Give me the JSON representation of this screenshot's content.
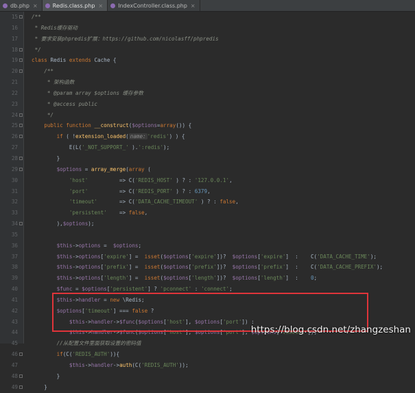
{
  "tabs": [
    {
      "label": "db.php",
      "active": false
    },
    {
      "label": "Redis.class.php",
      "active": true
    },
    {
      "label": "IndexController.class.php",
      "active": false
    }
  ],
  "lines": [
    {
      "n": "15",
      "fold": true,
      "tokens": [
        [
          "cm",
          "/**"
        ]
      ]
    },
    {
      "n": "16",
      "tokens": [
        [
          "cm",
          " * Redis缓存驱动"
        ]
      ]
    },
    {
      "n": "17",
      "tokens": [
        [
          "cm",
          " * 要求安装phpredis扩展：https://github.com/nicolasff/phpredis"
        ]
      ]
    },
    {
      "n": "18",
      "fold": true,
      "tokens": [
        [
          "cm",
          " */"
        ]
      ]
    },
    {
      "n": "19",
      "fold": true,
      "tokens": [
        [
          "kw",
          "class "
        ],
        [
          "",
          "Redis "
        ],
        [
          "kw",
          "extends "
        ],
        [
          "",
          "Cache {"
        ]
      ]
    },
    {
      "n": "20",
      "fold": true,
      "tokens": [
        [
          "cm",
          "    /**"
        ]
      ]
    },
    {
      "n": "21",
      "tokens": [
        [
          "cm",
          "     * 架构函数"
        ]
      ]
    },
    {
      "n": "22",
      "tokens": [
        [
          "cm",
          "     * @param array $options 缓存参数"
        ]
      ]
    },
    {
      "n": "23",
      "tokens": [
        [
          "cm",
          "     * @access public"
        ]
      ]
    },
    {
      "n": "24",
      "fold": true,
      "tokens": [
        [
          "cm",
          "     */"
        ]
      ]
    },
    {
      "n": "25",
      "fold": true,
      "tokens": [
        [
          "kw",
          "    public function "
        ],
        [
          "fn",
          "__construct"
        ],
        [
          "",
          "("
        ],
        [
          "vr",
          "$options"
        ],
        [
          "",
          "="
        ],
        [
          "kw",
          "array"
        ],
        [
          "",
          "()) {"
        ]
      ]
    },
    {
      "n": "26",
      "fold": true,
      "tokens": [
        [
          "kw",
          "        if "
        ],
        [
          "",
          "( !"
        ],
        [
          "fn",
          "extension_loaded"
        ],
        [
          "",
          "("
        ],
        [
          "hint",
          "name:"
        ],
        [
          "st",
          "'redis'"
        ],
        [
          "",
          ") ) {"
        ]
      ]
    },
    {
      "n": "27",
      "tokens": [
        [
          "",
          "            E(L("
        ],
        [
          "st",
          "'_NOT_SUPPORT_'"
        ],
        [
          "",
          " )."
        ],
        [
          "st",
          "':redis'"
        ],
        [
          "",
          ");"
        ]
      ]
    },
    {
      "n": "28",
      "fold": true,
      "tokens": [
        [
          "",
          "        }"
        ]
      ]
    },
    {
      "n": "29",
      "fold": true,
      "tokens": [
        [
          "vr",
          "        $options "
        ],
        [
          "",
          "= "
        ],
        [
          "fn",
          "array_merge"
        ],
        [
          "",
          "("
        ],
        [
          "kw",
          "array "
        ],
        [
          "",
          "("
        ]
      ]
    },
    {
      "n": "30",
      "tokens": [
        [
          "st",
          "            'host'"
        ],
        [
          "",
          "          => C("
        ],
        [
          "st",
          "'REDIS_HOST'"
        ],
        [
          "",
          " ) ? : "
        ],
        [
          "st",
          "'127.0.0.1'"
        ],
        [
          "",
          ","
        ]
      ]
    },
    {
      "n": "31",
      "tokens": [
        [
          "st",
          "            'port'"
        ],
        [
          "",
          "          => C("
        ],
        [
          "st",
          "'REDIS_PORT'"
        ],
        [
          "",
          " ) ? : "
        ],
        [
          "nm",
          "6379"
        ],
        [
          "",
          ","
        ]
      ]
    },
    {
      "n": "32",
      "tokens": [
        [
          "st",
          "            'timeout'"
        ],
        [
          "",
          "       => C("
        ],
        [
          "st",
          "'DATA_CACHE_TIMEOUT'"
        ],
        [
          "",
          " ) ? : "
        ],
        [
          "kw",
          "false"
        ],
        [
          "",
          ","
        ]
      ]
    },
    {
      "n": "33",
      "tokens": [
        [
          "st",
          "            'persistent'"
        ],
        [
          "",
          "    => "
        ],
        [
          "kw",
          "false"
        ],
        [
          "",
          ","
        ]
      ]
    },
    {
      "n": "34",
      "fold": true,
      "tokens": [
        [
          "",
          "        ),"
        ],
        [
          "vr",
          "$options"
        ],
        [
          "",
          ");"
        ]
      ]
    },
    {
      "n": "35",
      "tokens": [
        [
          "",
          ""
        ]
      ]
    },
    {
      "n": "36",
      "tokens": [
        [
          "th",
          "        $this"
        ],
        [
          "",
          "->"
        ],
        [
          "vr",
          "options "
        ],
        [
          "",
          "=  "
        ],
        [
          "vr",
          "$options"
        ],
        [
          "",
          ";"
        ]
      ]
    },
    {
      "n": "37",
      "tokens": [
        [
          "th",
          "        $this"
        ],
        [
          "",
          "->"
        ],
        [
          "vr",
          "options"
        ],
        [
          "",
          "["
        ],
        [
          "st",
          "'expire'"
        ],
        [
          "",
          "] =  "
        ],
        [
          "kw",
          "isset"
        ],
        [
          "",
          "("
        ],
        [
          "vr",
          "$options"
        ],
        [
          "",
          "["
        ],
        [
          "st",
          "'expire'"
        ],
        [
          "",
          "])?  "
        ],
        [
          "vr",
          "$options"
        ],
        [
          "",
          "["
        ],
        [
          "st",
          "'expire'"
        ],
        [
          "",
          "]  :    C("
        ],
        [
          "st",
          "'DATA_CACHE_TIME'"
        ],
        [
          "",
          ");"
        ]
      ]
    },
    {
      "n": "38",
      "tokens": [
        [
          "th",
          "        $this"
        ],
        [
          "",
          "->"
        ],
        [
          "vr",
          "options"
        ],
        [
          "",
          "["
        ],
        [
          "st",
          "'prefix'"
        ],
        [
          "",
          "] =  "
        ],
        [
          "kw",
          "isset"
        ],
        [
          "",
          "("
        ],
        [
          "vr",
          "$options"
        ],
        [
          "",
          "["
        ],
        [
          "st",
          "'prefix'"
        ],
        [
          "",
          "])?  "
        ],
        [
          "vr",
          "$options"
        ],
        [
          "",
          "["
        ],
        [
          "st",
          "'prefix'"
        ],
        [
          "",
          "]  :    C("
        ],
        [
          "st",
          "'DATA_CACHE_PREFIX'"
        ],
        [
          "",
          ");"
        ]
      ]
    },
    {
      "n": "39",
      "tokens": [
        [
          "th",
          "        $this"
        ],
        [
          "",
          "->"
        ],
        [
          "vr",
          "options"
        ],
        [
          "",
          "["
        ],
        [
          "st",
          "'length'"
        ],
        [
          "",
          "] =  "
        ],
        [
          "kw",
          "isset"
        ],
        [
          "",
          "("
        ],
        [
          "vr",
          "$options"
        ],
        [
          "",
          "["
        ],
        [
          "st",
          "'length'"
        ],
        [
          "",
          "])?  "
        ],
        [
          "vr",
          "$options"
        ],
        [
          "",
          "["
        ],
        [
          "st",
          "'length'"
        ],
        [
          "",
          "]  :    "
        ],
        [
          "nm",
          "0"
        ],
        [
          "",
          ";"
        ]
      ]
    },
    {
      "n": "40",
      "tokens": [
        [
          "vr",
          "        $func "
        ],
        [
          "",
          "= "
        ],
        [
          "vr",
          "$options"
        ],
        [
          "",
          "["
        ],
        [
          "st",
          "'persistent'"
        ],
        [
          "",
          "] ? "
        ],
        [
          "st",
          "'pconnect' "
        ],
        [
          "",
          ": "
        ],
        [
          "st",
          "'connect'"
        ],
        [
          "",
          ";"
        ]
      ]
    },
    {
      "n": "41",
      "tokens": [
        [
          "th",
          "        $this"
        ],
        [
          "",
          "->"
        ],
        [
          "vr",
          "handler "
        ],
        [
          "",
          "= "
        ],
        [
          "kw",
          "new "
        ],
        [
          "",
          "\\Redis;"
        ]
      ]
    },
    {
      "n": "42",
      "tokens": [
        [
          "vr",
          "        $options"
        ],
        [
          "",
          "["
        ],
        [
          "st",
          "'timeout'"
        ],
        [
          "",
          "] === "
        ],
        [
          "kw",
          "false "
        ],
        [
          "",
          "?"
        ]
      ]
    },
    {
      "n": "43",
      "tokens": [
        [
          "th",
          "            $this"
        ],
        [
          "",
          "->"
        ],
        [
          "vr",
          "handler"
        ],
        [
          "",
          "->"
        ],
        [
          "vr",
          "$func"
        ],
        [
          "",
          "("
        ],
        [
          "vr",
          "$options"
        ],
        [
          "",
          "["
        ],
        [
          "st",
          "'host'"
        ],
        [
          "",
          "], "
        ],
        [
          "vr",
          "$options"
        ],
        [
          "",
          "["
        ],
        [
          "st",
          "'port'"
        ],
        [
          "",
          "]) :"
        ]
      ]
    },
    {
      "n": "44",
      "tokens": [
        [
          "th",
          "            $this"
        ],
        [
          "",
          "->"
        ],
        [
          "vr",
          "handler"
        ],
        [
          "",
          "->"
        ],
        [
          "vr",
          "$func"
        ],
        [
          "",
          "("
        ],
        [
          "vr",
          "$options"
        ],
        [
          "",
          "["
        ],
        [
          "st",
          "'host'"
        ],
        [
          "",
          "], "
        ],
        [
          "vr",
          "$options"
        ],
        [
          "",
          "["
        ],
        [
          "st",
          "'port'"
        ],
        [
          "",
          "], "
        ],
        [
          "vr",
          "$options"
        ],
        [
          "",
          "["
        ],
        [
          "st",
          "'timeout'"
        ],
        [
          "",
          "]);"
        ]
      ]
    },
    {
      "n": "45",
      "tokens": [
        [
          "cm",
          "        //从配置文件里面获取设置的密码值"
        ]
      ]
    },
    {
      "n": "46",
      "fold": true,
      "tokens": [
        [
          "kw",
          "        if"
        ],
        [
          "",
          "(C("
        ],
        [
          "st",
          "'REDIS_AUTH'"
        ],
        [
          "",
          ")){"
        ]
      ]
    },
    {
      "n": "47",
      "tokens": [
        [
          "th",
          "            $this"
        ],
        [
          "",
          "->"
        ],
        [
          "vr",
          "handler"
        ],
        [
          "",
          "->"
        ],
        [
          "fn",
          "auth"
        ],
        [
          "",
          "(C("
        ],
        [
          "st",
          "'REDIS_AUTH'"
        ],
        [
          "",
          "));"
        ]
      ]
    },
    {
      "n": "48",
      "fold": true,
      "tokens": [
        [
          "",
          "        }"
        ]
      ]
    },
    {
      "n": "49",
      "fold": true,
      "tokens": [
        [
          "",
          "    }"
        ]
      ]
    }
  ],
  "watermark": "https://blog.csdn.net/zhangzeshan"
}
